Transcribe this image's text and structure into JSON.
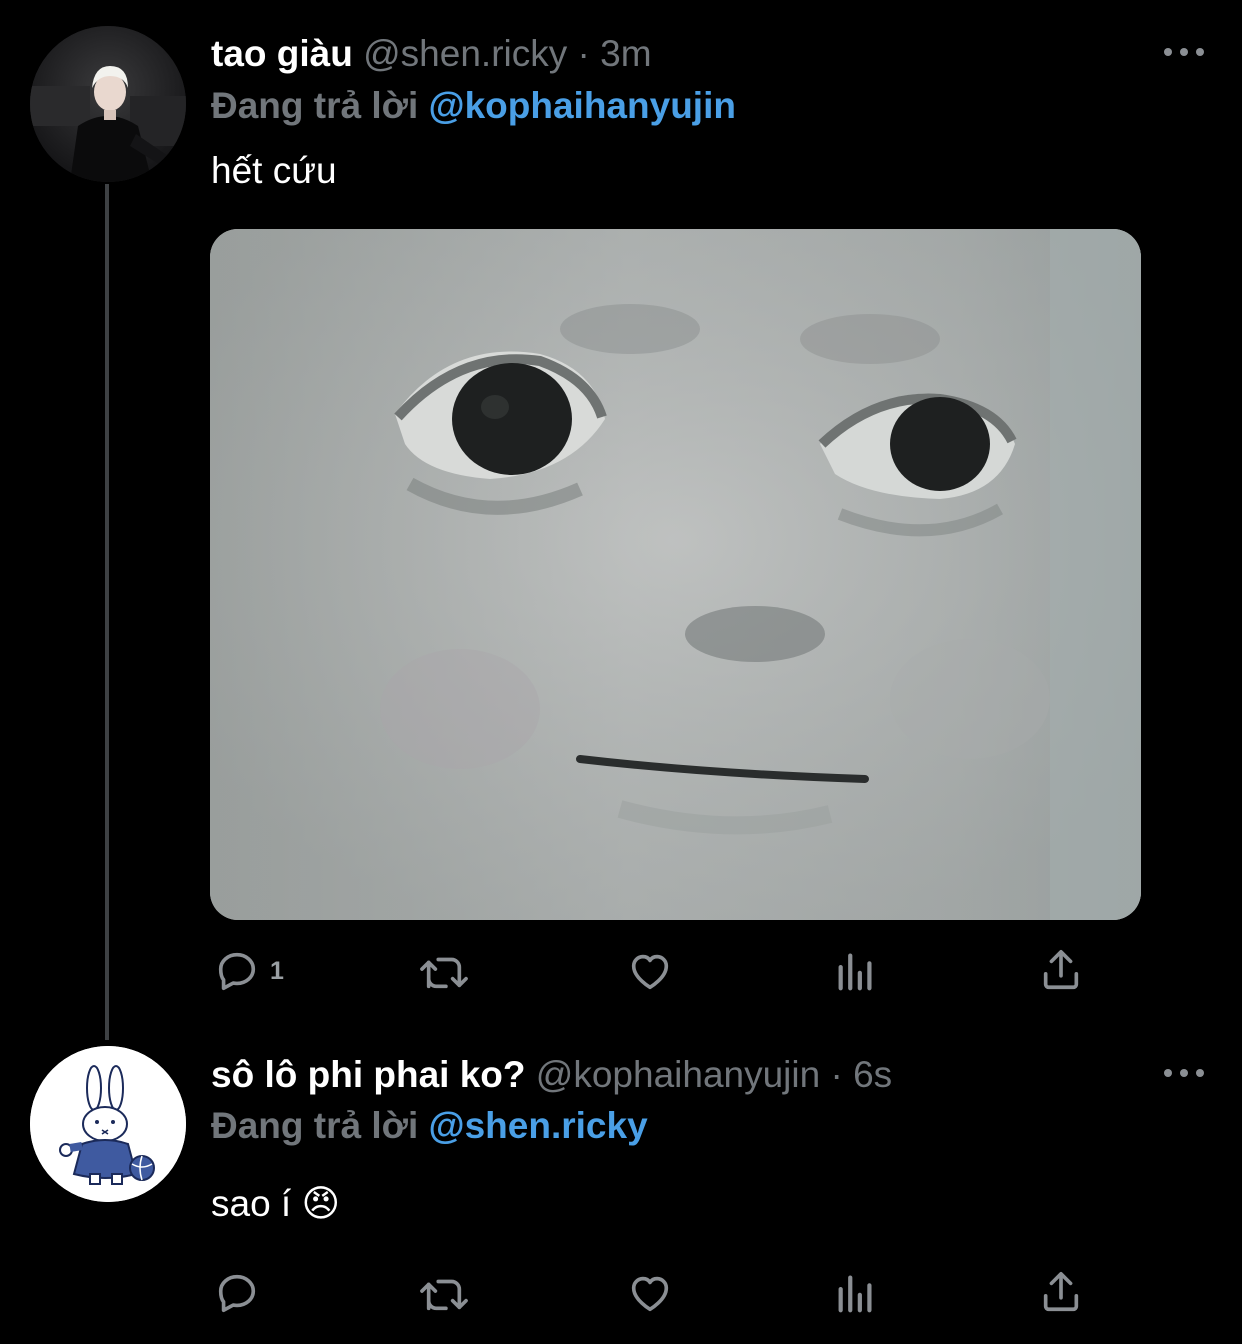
{
  "tweets": [
    {
      "display_name": "tao giàu",
      "handle": "@shen.ricky",
      "separator": "·",
      "time": "3m",
      "reply_prefix": "Đang trả lời",
      "reply_to": "@kophaihanyujin",
      "text": "hết cứu",
      "has_image": true,
      "reply_count": "1",
      "icons": [
        "reply-icon",
        "retweet-icon",
        "like-icon",
        "views-icon",
        "share-icon"
      ]
    },
    {
      "display_name": "sô lô phi phai ko?",
      "handle": "@kophaihanyujin",
      "separator": "·",
      "time": "6s",
      "reply_prefix": "Đang trả lời",
      "reply_to": "@shen.ricky",
      "text": "sao í 😠",
      "has_image": false,
      "reply_count": "",
      "icons": [
        "reply-icon",
        "retweet-icon",
        "like-icon",
        "views-icon",
        "share-icon"
      ]
    }
  ],
  "colors": {
    "background": "#000000",
    "mention": "#4a9fe6",
    "secondary_text": "#71767b",
    "thread_line": "#3e4144"
  }
}
